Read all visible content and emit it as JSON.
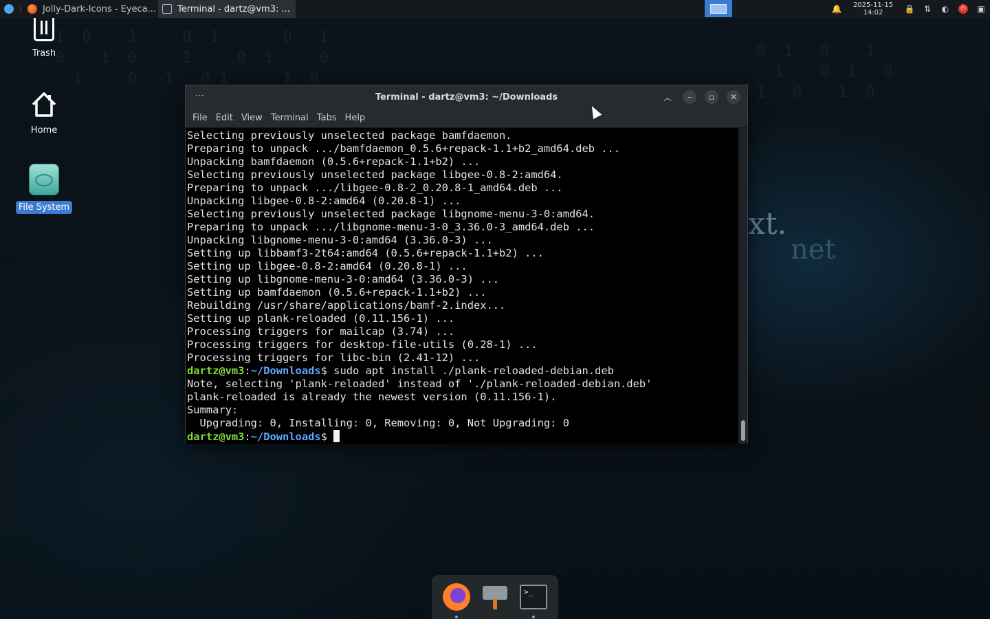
{
  "taskbar": {
    "tasks": [
      {
        "label": "Jolly-Dark-Icons - Eyeca...",
        "icon": "firefox-icon",
        "active": false
      },
      {
        "label": "Terminal - dartz@vm3: ...",
        "icon": "terminal-icon",
        "active": true
      }
    ],
    "clock": {
      "date": "2025-11-15",
      "time": "14:02"
    },
    "tray_icons": [
      "notification-bell-icon",
      "lock-icon",
      "network-icon",
      "steam-icon",
      "power-icon",
      "window-list-icon"
    ]
  },
  "desktop": {
    "icons": [
      {
        "label": "Trash",
        "icon": "trash-icon",
        "selected": false
      },
      {
        "label": "Home",
        "icon": "home-icon",
        "selected": false
      },
      {
        "label": "File System",
        "icon": "drive-icon",
        "selected": true
      }
    ]
  },
  "terminal": {
    "title": "Terminal - dartz@vm3: ~/Downloads",
    "menu": [
      "File",
      "Edit",
      "View",
      "Terminal",
      "Tabs",
      "Help"
    ],
    "lines": [
      "Selecting previously unselected package bamfdaemon.",
      "Preparing to unpack .../bamfdaemon_0.5.6+repack-1.1+b2_amd64.deb ...",
      "Unpacking bamfdaemon (0.5.6+repack-1.1+b2) ...",
      "Selecting previously unselected package libgee-0.8-2:amd64.",
      "Preparing to unpack .../libgee-0.8-2_0.20.8-1_amd64.deb ...",
      "Unpacking libgee-0.8-2:amd64 (0.20.8-1) ...",
      "Selecting previously unselected package libgnome-menu-3-0:amd64.",
      "Preparing to unpack .../libgnome-menu-3-0_3.36.0-3_amd64.deb ...",
      "Unpacking libgnome-menu-3-0:amd64 (3.36.0-3) ...",
      "Setting up libbamf3-2t64:amd64 (0.5.6+repack-1.1+b2) ...",
      "Setting up libgee-0.8-2:amd64 (0.20.8-1) ...",
      "Setting up libgnome-menu-3-0:amd64 (3.36.0-3) ...",
      "Setting up bamfdaemon (0.5.6+repack-1.1+b2) ...",
      "Rebuilding /usr/share/applications/bamf-2.index...",
      "Setting up plank-reloaded (0.11.156-1) ...",
      "Processing triggers for mailcap (3.74) ...",
      "Processing triggers for desktop-file-utils (0.28-1) ...",
      "Processing triggers for libc-bin (2.41-12) ..."
    ],
    "prompt_user": "dartz@vm3",
    "prompt_path": "~/Downloads",
    "prompt_symbol": "$",
    "command": " sudo apt install ./plank-reloaded-debian.deb",
    "output": [
      "Note, selecting 'plank-reloaded' instead of './plank-reloaded-debian.deb'",
      "plank-reloaded is already the newest version (0.11.156-1).",
      "Summary:",
      "  Upgrading: 0, Installing: 0, Removing: 0, Not Upgrading: 0"
    ]
  },
  "dock": {
    "items": [
      {
        "icon": "firefox-icon",
        "running": true
      },
      {
        "icon": "package-installer-icon",
        "running": false
      },
      {
        "icon": "terminal-icon",
        "running": true
      }
    ],
    "terminal_glyph": ">_"
  },
  "wallpaper_text": "xt.e  net"
}
